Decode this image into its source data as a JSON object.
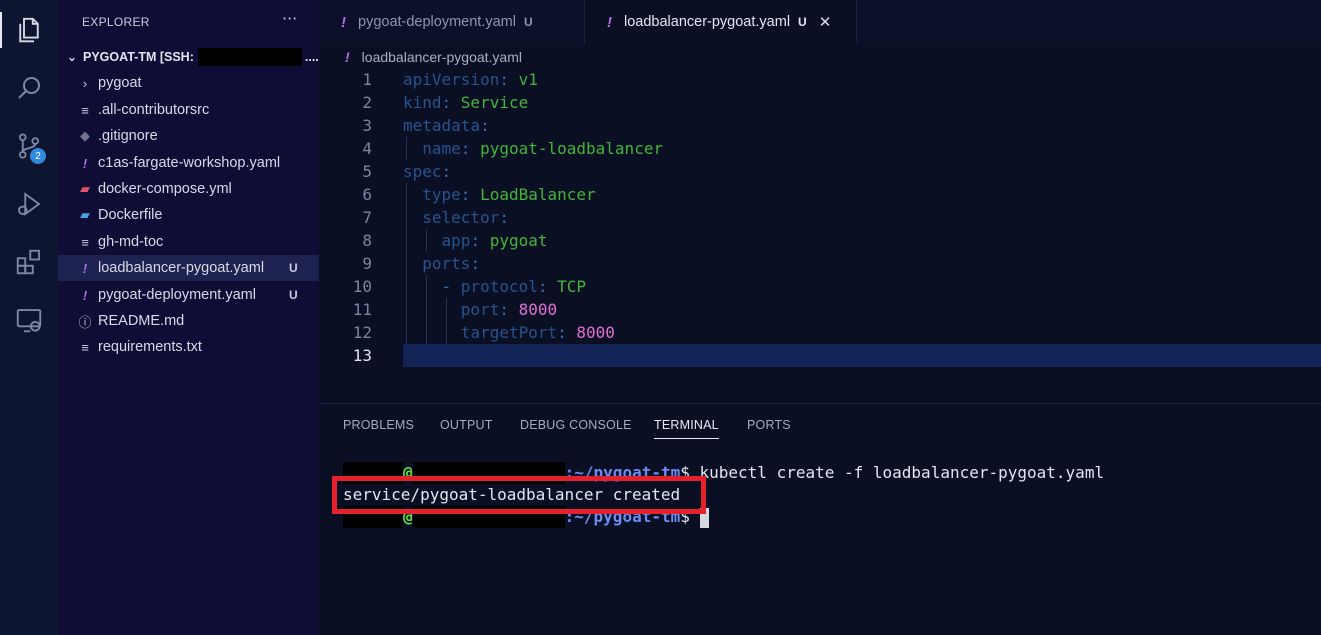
{
  "activity_bar": {
    "items": [
      {
        "icon": "files-icon",
        "active": true
      },
      {
        "icon": "search-icon"
      },
      {
        "icon": "source-control-icon",
        "badge": "2"
      },
      {
        "icon": "run-debug-icon"
      },
      {
        "icon": "extensions-icon"
      },
      {
        "icon": "remote-explorer-icon"
      }
    ]
  },
  "sidebar": {
    "title": "EXPLORER",
    "more": "···",
    "folder": {
      "label": "PYGOAT-TM [SSH:",
      "ellipsis": "...."
    },
    "items": [
      {
        "name": "pygoat",
        "icon": "chevron-right-icon",
        "status": ""
      },
      {
        "name": ".all-contributorsrc",
        "icon": "lines-file-icon",
        "status": ""
      },
      {
        "name": ".gitignore",
        "icon": "git-icon",
        "status": ""
      },
      {
        "name": "c1as-fargate-workshop.yaml",
        "icon": "yaml-icon",
        "status": ""
      },
      {
        "name": "docker-compose.yml",
        "icon": "docker-compose-icon",
        "status": ""
      },
      {
        "name": "Dockerfile",
        "icon": "docker-icon",
        "status": ""
      },
      {
        "name": "gh-md-toc",
        "icon": "lines-file-icon",
        "status": ""
      },
      {
        "name": "loadbalancer-pygoat.yaml",
        "icon": "yaml-icon",
        "status": "U"
      },
      {
        "name": "pygoat-deployment.yaml",
        "icon": "yaml-icon",
        "status": "U"
      },
      {
        "name": "README.md",
        "icon": "info-icon",
        "status": ""
      },
      {
        "name": "requirements.txt",
        "icon": "lines-file-icon",
        "status": ""
      }
    ]
  },
  "tabs": [
    {
      "label": "pygoat-deployment.yaml",
      "status": "U",
      "icon": "!"
    },
    {
      "label": "loadbalancer-pygoat.yaml",
      "status": "U",
      "icon": "!",
      "close": "✕"
    }
  ],
  "breadcrumb": {
    "icon": "!",
    "label": "loadbalancer-pygoat.yaml"
  },
  "editor": {
    "current_line": 13,
    "lines": [
      {
        "num": "1",
        "key": "apiVersion",
        "colon": ": ",
        "value": "v1",
        "indent": ""
      },
      {
        "num": "2",
        "key": "kind",
        "colon": ": ",
        "value": "Service",
        "indent": ""
      },
      {
        "num": "3",
        "key": "metadata",
        "colon": ":",
        "value": "",
        "indent": ""
      },
      {
        "num": "4",
        "key": "name",
        "colon": ": ",
        "value": "pygoat-loadbalancer",
        "indent": "  "
      },
      {
        "num": "5",
        "key": "spec",
        "colon": ":",
        "value": "",
        "indent": ""
      },
      {
        "num": "6",
        "key": "type",
        "colon": ": ",
        "value": "LoadBalancer",
        "indent": "  "
      },
      {
        "num": "7",
        "key": "selector",
        "colon": ":",
        "value": "",
        "indent": "  "
      },
      {
        "num": "8",
        "key": "app",
        "colon": ": ",
        "value": "pygoat",
        "indent": "    "
      },
      {
        "num": "9",
        "key": "ports",
        "colon": ":",
        "value": "",
        "indent": "  "
      },
      {
        "num": "10",
        "key": "protocol",
        "colon": ": ",
        "value": "TCP",
        "indent": "    - "
      },
      {
        "num": "11",
        "key": "port",
        "colon": ": ",
        "value": "8000",
        "indent": "      ",
        "numeric": true
      },
      {
        "num": "12",
        "key": "targetPort",
        "colon": ": ",
        "value": "8000",
        "indent": "      ",
        "numeric": true
      },
      {
        "num": "13",
        "key": "",
        "colon": "",
        "value": "",
        "indent": ""
      }
    ]
  },
  "panel": {
    "tabs": [
      "PROBLEMS",
      "OUTPUT",
      "DEBUG CONSOLE",
      "TERMINAL",
      "PORTS"
    ],
    "active_tab": "TERMINAL",
    "terminal": {
      "line1": {
        "at": "@",
        "path": ":~/pygoat-tm",
        "dollar": "$ ",
        "command": "kubectl create -f loadbalancer-pygoat.yaml"
      },
      "line2": {
        "output": "service/pygoat-loadbalancer created"
      },
      "line3": {
        "at": "@",
        "path": ":~/pygoat-tm",
        "dollar": "$ "
      }
    }
  },
  "colors": {
    "highlight": "#e5222c",
    "yaml_icon": "#b36de8",
    "string": "#42b53a",
    "number": "#e26fd6"
  }
}
